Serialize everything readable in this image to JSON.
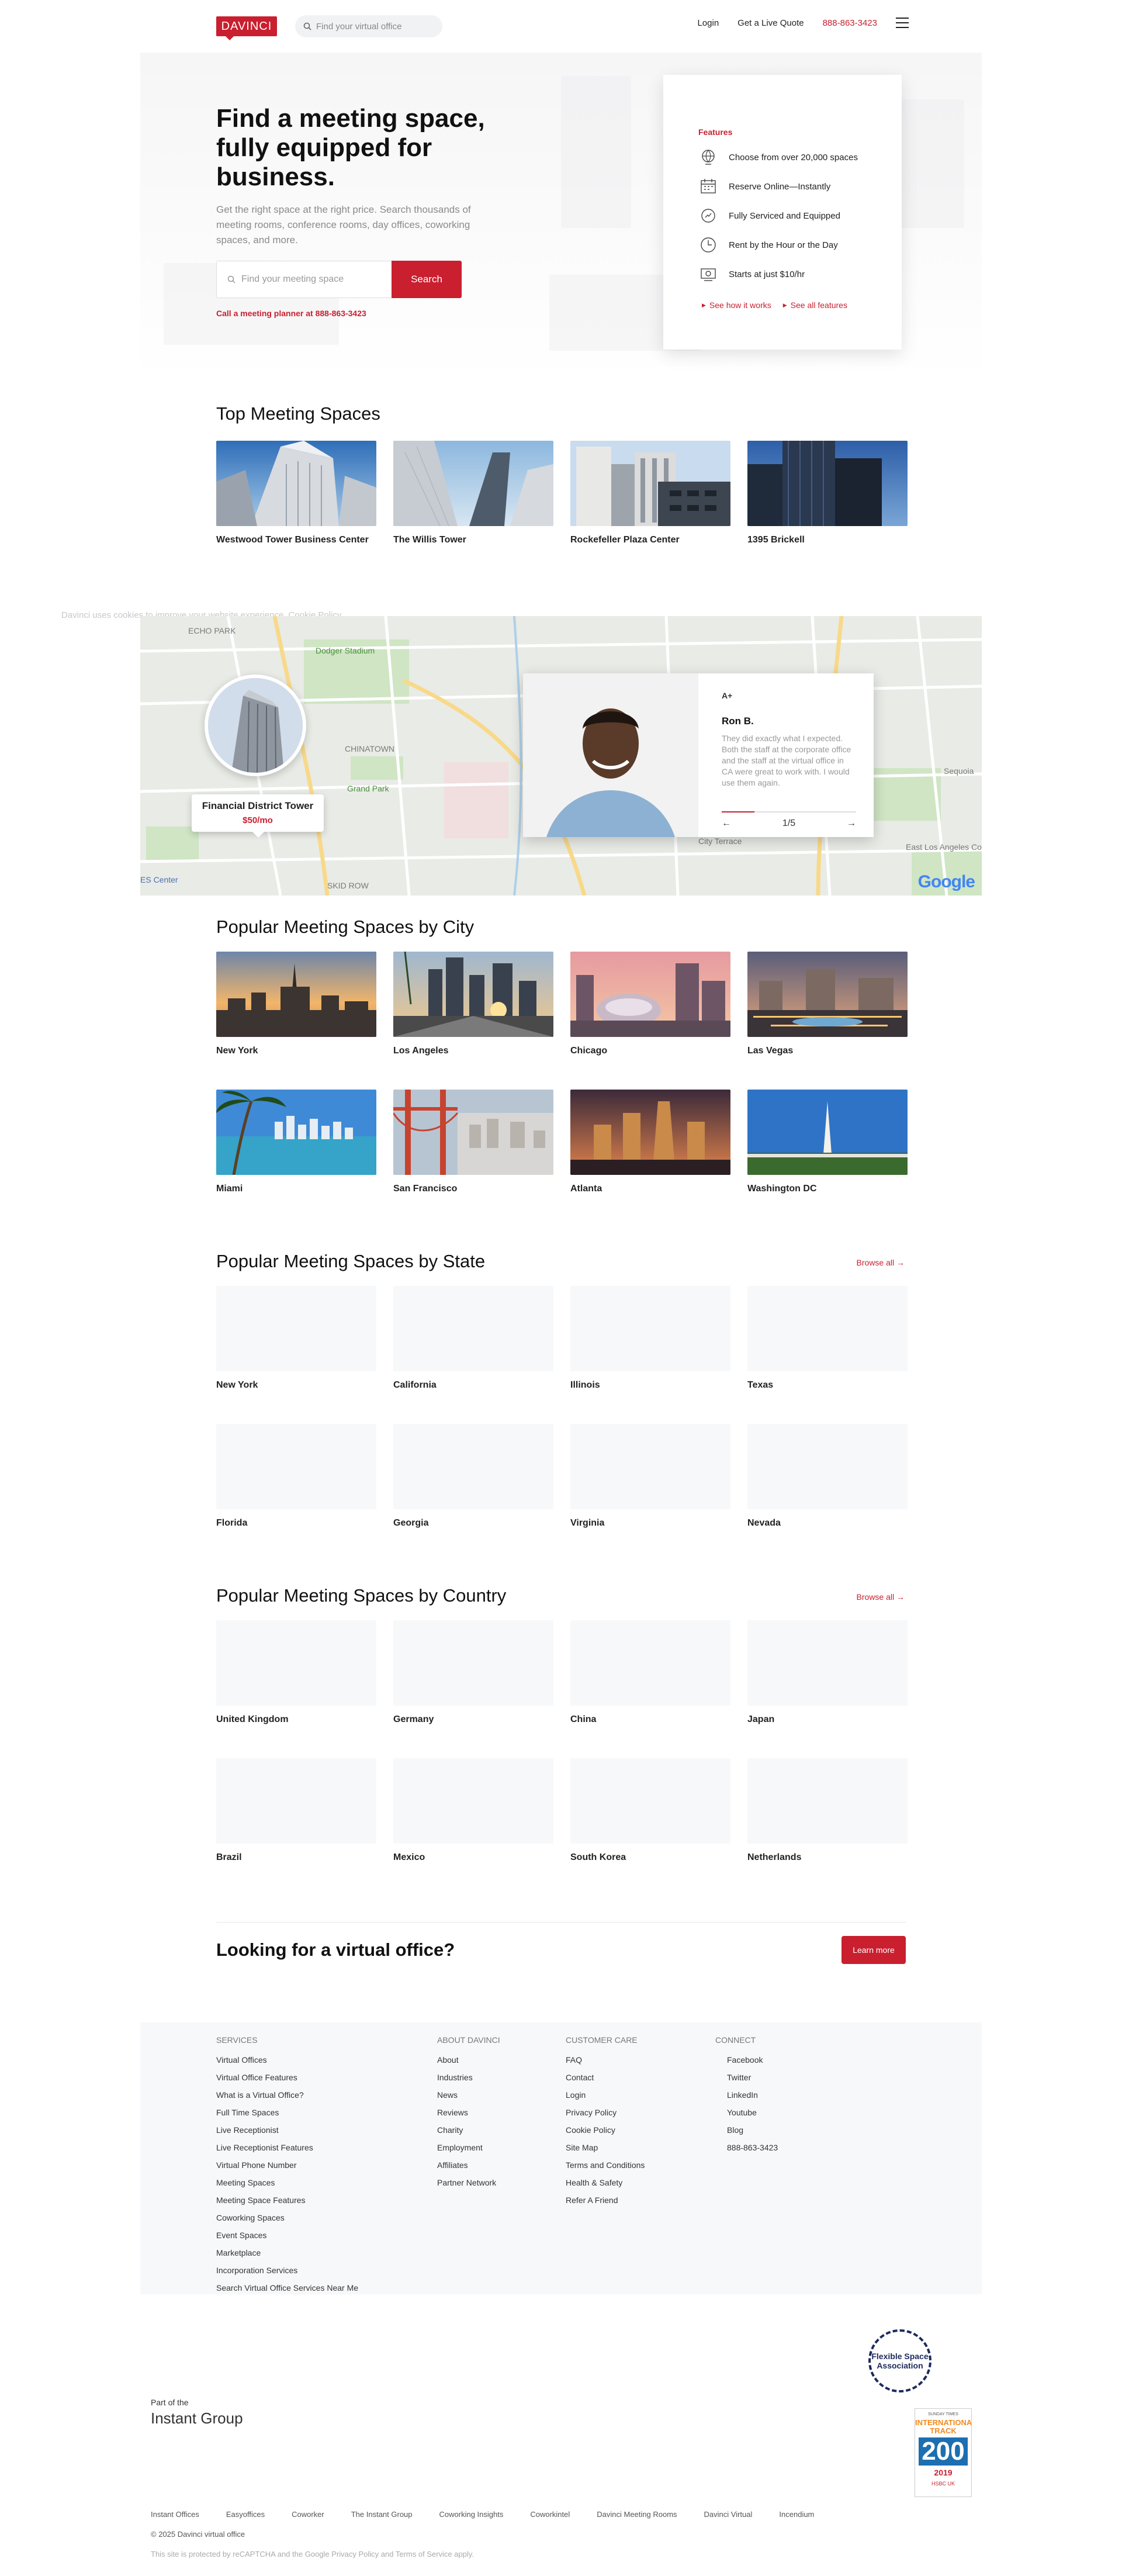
{
  "header": {
    "logo": "DAVINCI",
    "search_placeholder": "Find your virtual office",
    "login": "Login",
    "quote": "Get a Live Quote",
    "phone": "888-863-3423",
    "menu_icon": "hamburger-icon"
  },
  "hero": {
    "title": "Find a meeting space, fully equipped for business.",
    "subtitle": "Get the right space at the right price. Search thousands of meeting rooms, conference rooms, day offices, coworking spaces, and more.",
    "search_placeholder": "Find your meeting space",
    "search_button": "Search",
    "planner": "Call a meeting planner at 888-863-3423"
  },
  "features": {
    "title": "Features",
    "items": [
      {
        "icon": "globe-icon",
        "label": "Choose from over 20,000 spaces"
      },
      {
        "icon": "calendar-icon",
        "label": "Reserve Online—Instantly"
      },
      {
        "icon": "service-icon",
        "label": "Fully Serviced and Equipped"
      },
      {
        "icon": "clock-icon",
        "label": "Rent by the Hour or the Day"
      },
      {
        "icon": "price-tag-icon",
        "label": "Starts at just $10/hr"
      }
    ],
    "link_how": "See how it works",
    "link_all": "See all features"
  },
  "top_spaces": {
    "title": "Top Meeting Spaces",
    "items": [
      "Westwood Tower Business Center",
      "The Willis Tower",
      "Rockefeller Plaza Center",
      "1395 Brickell"
    ]
  },
  "cookie_note": "Davinci uses cookies to improve your website experience. Cookie Policy",
  "map": {
    "pin_name": "Financial District Tower",
    "pin_price": "$50/mo",
    "rating": "A+",
    "reviewer": "Ron B.",
    "quote": "They did exactly what I expected. Both the staff at the corporate office and the staff at the virtual office in CA were great to work with. I would use them again.",
    "page": "1/5",
    "labels": [
      "ECHO PARK",
      "Dodger Stadium",
      "CHINATOWN",
      "Grand Park",
      "SKID ROW",
      "City Terrace",
      "East Los Angeles College",
      "ES Center",
      "Sequoia"
    ],
    "google": "Google"
  },
  "cities": {
    "title": "Popular Meeting Spaces by City",
    "items": [
      "New York",
      "Los Angeles",
      "Chicago",
      "Las Vegas",
      "Miami",
      "San Francisco",
      "Atlanta",
      "Washington DC"
    ]
  },
  "states": {
    "title": "Popular Meeting Spaces by State",
    "browse": "Browse all →",
    "items": [
      "New York",
      "California",
      "Illinois",
      "Texas",
      "Florida",
      "Georgia",
      "Virginia",
      "Nevada"
    ]
  },
  "countries": {
    "title": "Popular Meeting Spaces by Country",
    "browse": "Browse all →",
    "items": [
      "United Kingdom",
      "Germany",
      "China",
      "Japan",
      "Brazil",
      "Mexico",
      "South Korea",
      "Netherlands"
    ]
  },
  "virtual": {
    "title": "Looking for a virtual office?",
    "button": "Learn more"
  },
  "footer": {
    "services": {
      "title": "SERVICES",
      "items": [
        "Virtual Offices",
        "Virtual Office Features",
        "What is a Virtual Office?",
        "Full Time Spaces",
        "Live Receptionist",
        "Live Receptionist Features",
        "Virtual Phone Number",
        "Meeting Spaces",
        "Meeting Space Features",
        "Coworking Spaces",
        "Event Spaces",
        "Marketplace",
        "Incorporation Services",
        "Search Virtual Office Services Near Me"
      ]
    },
    "about": {
      "title": "ABOUT DAVINCI",
      "items": [
        "About",
        "Industries",
        "News",
        "Reviews",
        "Charity",
        "Employment",
        "Affiliates",
        "Partner Network"
      ]
    },
    "care": {
      "title": "CUSTOMER CARE",
      "items": [
        "FAQ",
        "Contact",
        "Login",
        "Privacy Policy",
        "Cookie Policy",
        "Site Map",
        "Terms and Conditions",
        "Health & Safety",
        "Refer A Friend"
      ]
    },
    "connect": {
      "title": "CONNECT",
      "items": [
        "Facebook",
        "Twitter",
        "LinkedIn",
        "Youtube",
        "Blog",
        "888-863-3423"
      ]
    }
  },
  "bottom": {
    "part_of": "Part of the",
    "group": "Instant Group",
    "fsa": "Flexible Space Association",
    "badge_top": "SUNDAY TIMES",
    "badge_intl": "INTERNATIONAL TRACK",
    "badge_num": "200",
    "badge_year": "2019",
    "badge_sponsor": "HSBC UK",
    "links": [
      "Instant Offices",
      "Easyoffices",
      "Coworker",
      "The Instant Group",
      "Coworking Insights",
      "Coworkintel",
      "Davinci Meeting Rooms",
      "Davinci Virtual",
      "Incendium"
    ],
    "copyright": "© 2025 Davinci virtual office",
    "recaptcha": "This site is protected by reCAPTCHA and the Google Privacy Policy and Terms of Service apply."
  },
  "colors": {
    "brand": "#c91f2f",
    "footer_bg": "#f7f8fa"
  }
}
